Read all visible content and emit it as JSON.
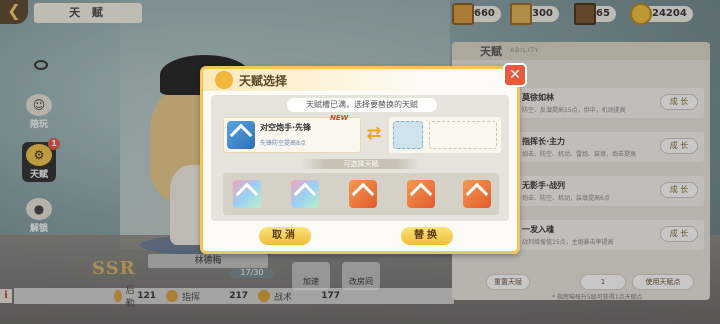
{
  "header": {
    "title": "天 赋",
    "resources": [
      {
        "icon": "chest-icon",
        "value": "660"
      },
      {
        "icon": "crate-icon",
        "value": "300"
      },
      {
        "icon": "cube-icon",
        "value": "65"
      },
      {
        "icon": "coin-icon",
        "value": "24204"
      }
    ]
  },
  "sidebar": {
    "items": [
      {
        "label": "陪玩",
        "icon": "companion-icon"
      },
      {
        "label": "天赋",
        "icon": "gear-icon",
        "badge": "1"
      },
      {
        "label": "解锁",
        "icon": "lock-icon"
      }
    ]
  },
  "character": {
    "rank": "SSR",
    "name": "林德梅",
    "level": "17/30"
  },
  "stats": [
    {
      "label": "后勤",
      "value": "121"
    },
    {
      "label": "指挥",
      "value": "217"
    },
    {
      "label": "战术",
      "value": "177"
    }
  ],
  "bottom_buttons": [
    "加速",
    "改房间"
  ],
  "talent_panel": {
    "title": "天赋",
    "subtitle": "ABILITY",
    "items": [
      {
        "name": "莫徐如林",
        "desc": "防空、反潜提高15点，供中，机动提高",
        "button": "成 长"
      },
      {
        "name": "指挥长·主力",
        "desc": "炮击、防空、机动、雷炮、装填，炮击提高",
        "button": "成 长"
      },
      {
        "name": "无影手·战列",
        "desc": "炮击、防空、机动，装填提高6点",
        "button": "成 长"
      },
      {
        "name": "一发入魂",
        "desc": "战列增援值15点，主炮暴击率提高",
        "button": "成 长"
      }
    ],
    "reset_button": "重置天赋",
    "count": "1",
    "use_button": "使用天赋点",
    "note": "* 指挥喵每升5级可获得1点天赋点"
  },
  "modal": {
    "title": "天赋选择",
    "hint": "天赋槽已满，选择要替换的天赋",
    "current_talent": {
      "name": "对空炮手·先锋",
      "desc": "先锋防空提高8点",
      "new_tag": "NEW"
    },
    "options_label": "可选择天赋",
    "options": [
      "talent-option-1",
      "talent-option-2",
      "talent-option-3",
      "talent-option-4",
      "talent-option-5"
    ],
    "cancel_button": "取消",
    "replace_button": "替换",
    "close": "✕"
  },
  "colors": {
    "accent": "#f3c55a",
    "close": "#e75a3c",
    "button": "#f0bd3a"
  }
}
